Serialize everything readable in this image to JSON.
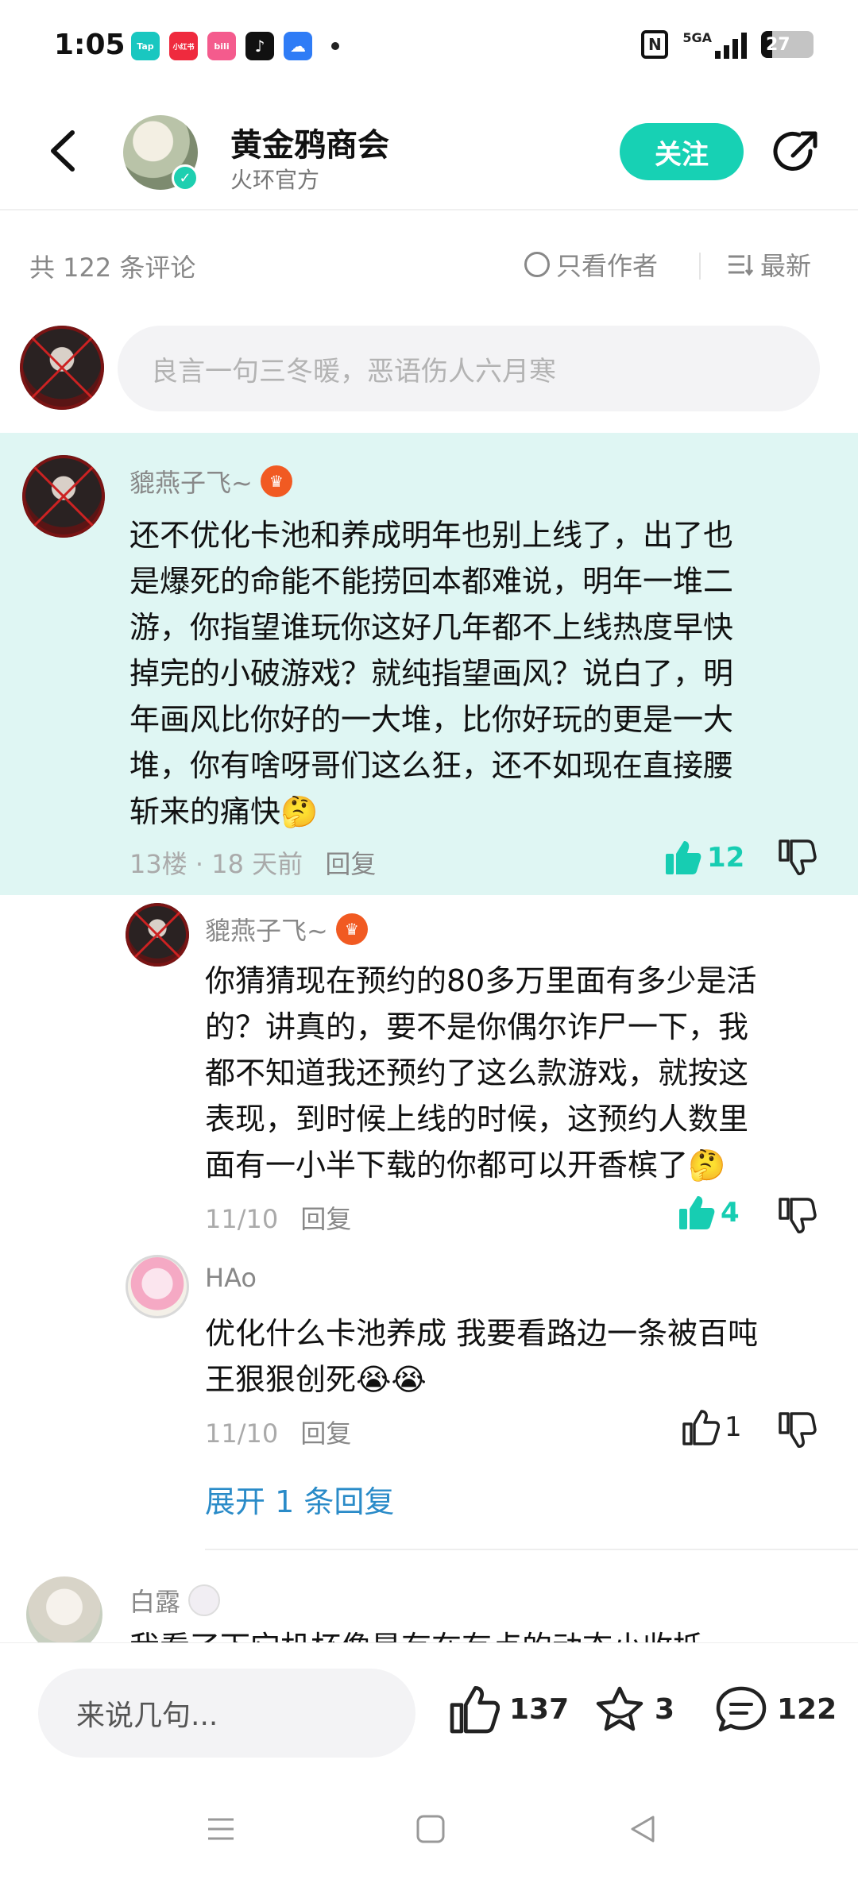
{
  "status_bar": {
    "time": "1:05",
    "apps": [
      {
        "icon": "taptap-app-icon",
        "label": "Tap",
        "color": "#19c7c0"
      },
      {
        "icon": "xiaohongshu-app-icon",
        "label": "小红书",
        "color": "#ef2a3e"
      },
      {
        "icon": "bilibili-app-icon",
        "label": "bili",
        "color": "#f45b8d"
      },
      {
        "icon": "tiktok-app-icon",
        "label": "♪",
        "color": "#111111"
      },
      {
        "icon": "baidu-netdisk-app-icon",
        "label": "☁",
        "color": "#2f7cf6"
      }
    ],
    "network": "5GA",
    "battery": "27"
  },
  "header": {
    "title": "黄金鸦商会",
    "subtitle": "火环官方",
    "follow_label": "关注"
  },
  "filter": {
    "count_text": "共 122 条评论",
    "author_only_label": "只看作者",
    "sort_label": "最新"
  },
  "input": {
    "placeholder": "良言一句三冬暖，恶语伤人六月寒"
  },
  "main_comment": {
    "username": "貔燕子飞~",
    "text_lines": [
      "还不优化卡池和养成明年也别上线了，出了也",
      "是爆死的命能不能捞回本都难说，明年一堆二",
      "游，你指望谁玩你这好几年都不上线热度早快",
      "掉完的小破游戏？就纯指望画风？说白了，明",
      "年画风比你好的一大堆，比你好玩的更是一大",
      "堆，你有啥呀哥们这么狂，还不如现在直接腰",
      "斩来的痛快🤔"
    ],
    "meta": "13楼 · 18 天前",
    "reply_label": "回复",
    "likes": "12"
  },
  "replies": [
    {
      "username": "貔燕子飞~",
      "text_lines": [
        "你猜猜现在预约的80多万里面有多少是活",
        "的？讲真的，要不是你偶尔诈尸一下，我",
        "都不知道我还预约了这么款游戏，就按这",
        "表现，到时候上线的时候，这预约人数里",
        "面有一小半下载的你都可以开香槟了🤔"
      ],
      "meta": "11/10",
      "reply_label": "回复",
      "likes": "4"
    },
    {
      "username": "HAo",
      "text_lines": [
        "优化什么卡池养成 我要看路边一条被百吨",
        "王狠狠创死😭😭"
      ],
      "meta": "11/10",
      "reply_label": "回复",
      "likes": "1"
    }
  ],
  "expand_label": "展开 1 条回复",
  "next_comment": {
    "username": "白露",
    "partial_text": "我看了下它机杯像是有在有点的动态小收抵"
  },
  "bottom_bar": {
    "input_placeholder": "来说几句...",
    "likes": "137",
    "favorites": "3",
    "comments": "122"
  },
  "colors": {
    "accent": "#17d1b4",
    "highlight_bg": "#dff6f3",
    "link": "#2a8bc8"
  }
}
